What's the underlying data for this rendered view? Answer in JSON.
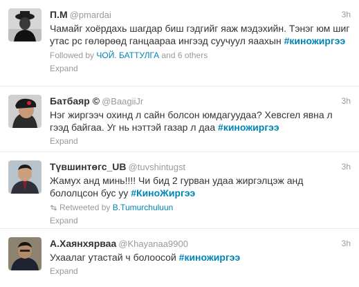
{
  "tweets": [
    {
      "fullname": "П.М",
      "username": "@pmardai",
      "time": "3h",
      "text": "Чамайг хоёрдахь шагдар биш гэдгийг  яаж мэдэхийн. Тэнэг юм шиг утас рс гөлөрөөд ганцаараа ингээд суучуул яаахын ",
      "hashtag": "#киножиргээ",
      "context_prefix": "Followed by ",
      "context_link": "ЧОЙ. БАТТУЛГА",
      "context_suffix": " and 6 others",
      "expand": "Expand"
    },
    {
      "fullname": "Батбаяр ©",
      "username": "@BaagiiJr",
      "time": "3h",
      "text": "Нэг жиргээч охинд л сайн болсон юмдагуудаа? Хевсгел явна л гээд байгаа. Уг нь нэттэй газар л даа ",
      "hashtag": "#киножиргээ",
      "expand": "Expand"
    },
    {
      "fullname": "Түвшинтөгс_UB",
      "username": "@tuvshintugst",
      "time": "3h",
      "text": "Жамух анд минь!!!! Чи бид 2 гурван удаа жиргэлцэж анд бололцсон бус уу ",
      "hashtag": "#КиноЖиргээ",
      "context_prefix": "Retweeted by ",
      "context_link": "B.Tumurchuluun",
      "expand": "Expand"
    },
    {
      "fullname": "А.Хаянхярваа",
      "username": "@Khayanaa9900",
      "time": "3h",
      "text": "Ухаалаг утастай ч болоосой ",
      "hashtag": "#киножиргээ",
      "expand": "Expand"
    }
  ],
  "icons": {
    "retweet": "retweet-icon"
  },
  "colors": {
    "link": "#0084b4",
    "muted": "#999999",
    "text": "#333333"
  }
}
